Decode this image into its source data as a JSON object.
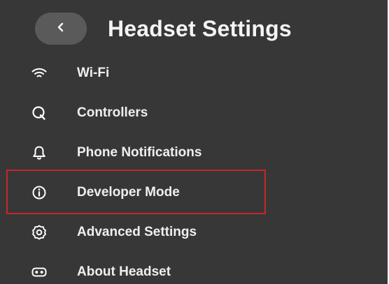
{
  "header": {
    "back_icon": "chevron-left-icon",
    "title": "Headset Settings"
  },
  "menu": {
    "items": [
      {
        "label": "Wi-Fi",
        "icon": "wifi-icon"
      },
      {
        "label": "Controllers",
        "icon": "controller-icon"
      },
      {
        "label": "Phone Notifications",
        "icon": "bell-icon"
      },
      {
        "label": "Developer Mode",
        "icon": "info-icon",
        "highlighted": true
      },
      {
        "label": "Advanced Settings",
        "icon": "gear-icon"
      },
      {
        "label": "About Headset",
        "icon": "headset-icon"
      }
    ]
  },
  "colors": {
    "background": "#373737",
    "back_button": "#5a5a5a",
    "text": "#efefef",
    "highlight_border": "#c4262c"
  }
}
